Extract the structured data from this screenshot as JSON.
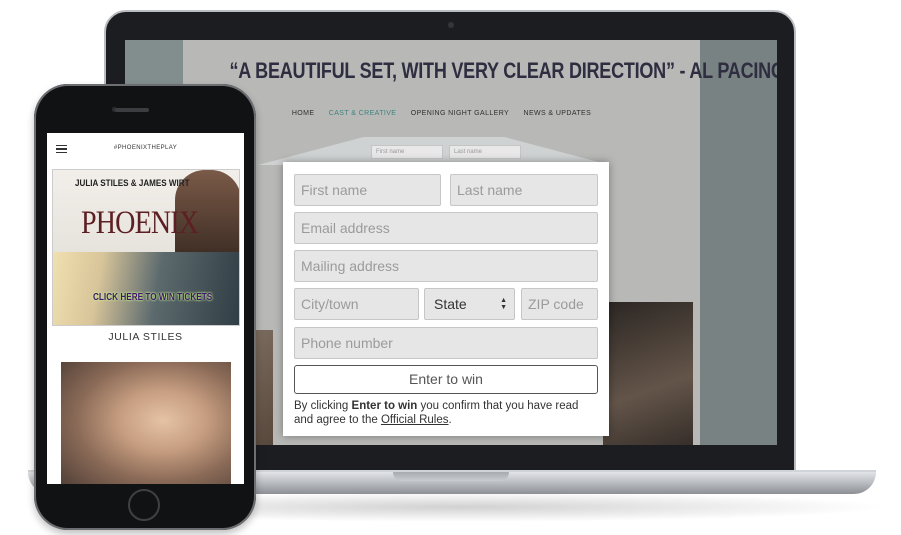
{
  "laptop": {
    "site": {
      "quote": "“A BEAUTIFUL SET, WITH VERY CLEAR DIRECTION” - AL PACINO",
      "nav": [
        {
          "label": "HOME",
          "active": false
        },
        {
          "label": "CAST & CREATIVE",
          "active": true
        },
        {
          "label": "OPENING NIGHT GALLERY",
          "active": false
        },
        {
          "label": "NEWS & UPDATES",
          "active": false
        }
      ],
      "ghost_fields": {
        "first": "First name",
        "last": "Last name"
      }
    },
    "form": {
      "first_name_placeholder": "First name",
      "last_name_placeholder": "Last name",
      "email_placeholder": "Email address",
      "mailing_placeholder": "Mailing address",
      "city_placeholder": "City/town",
      "state_selected": "State",
      "zip_placeholder": "ZIP code",
      "phone_placeholder": "Phone number",
      "submit_label": "Enter to win",
      "disclaimer_prefix": "By clicking ",
      "disclaimer_bold": "Enter to win",
      "disclaimer_middle": " you confirm that you have read and agree to the ",
      "disclaimer_link": "Official Rules",
      "disclaimer_suffix": "."
    }
  },
  "phone": {
    "hashtag": "#PHOENIXTHEPLAY",
    "poster": {
      "names": "JULIA STILES & JAMES WIRT",
      "title": "PHOENIX",
      "cta": "CLICK HERE TO WIN TICKETS"
    },
    "actor_name": "JULIA STILES"
  },
  "colors": {
    "nav_active": "#4aa7a0",
    "quote": "#32304a",
    "poster_title": "#5c1f23",
    "cta": "#40156c"
  }
}
